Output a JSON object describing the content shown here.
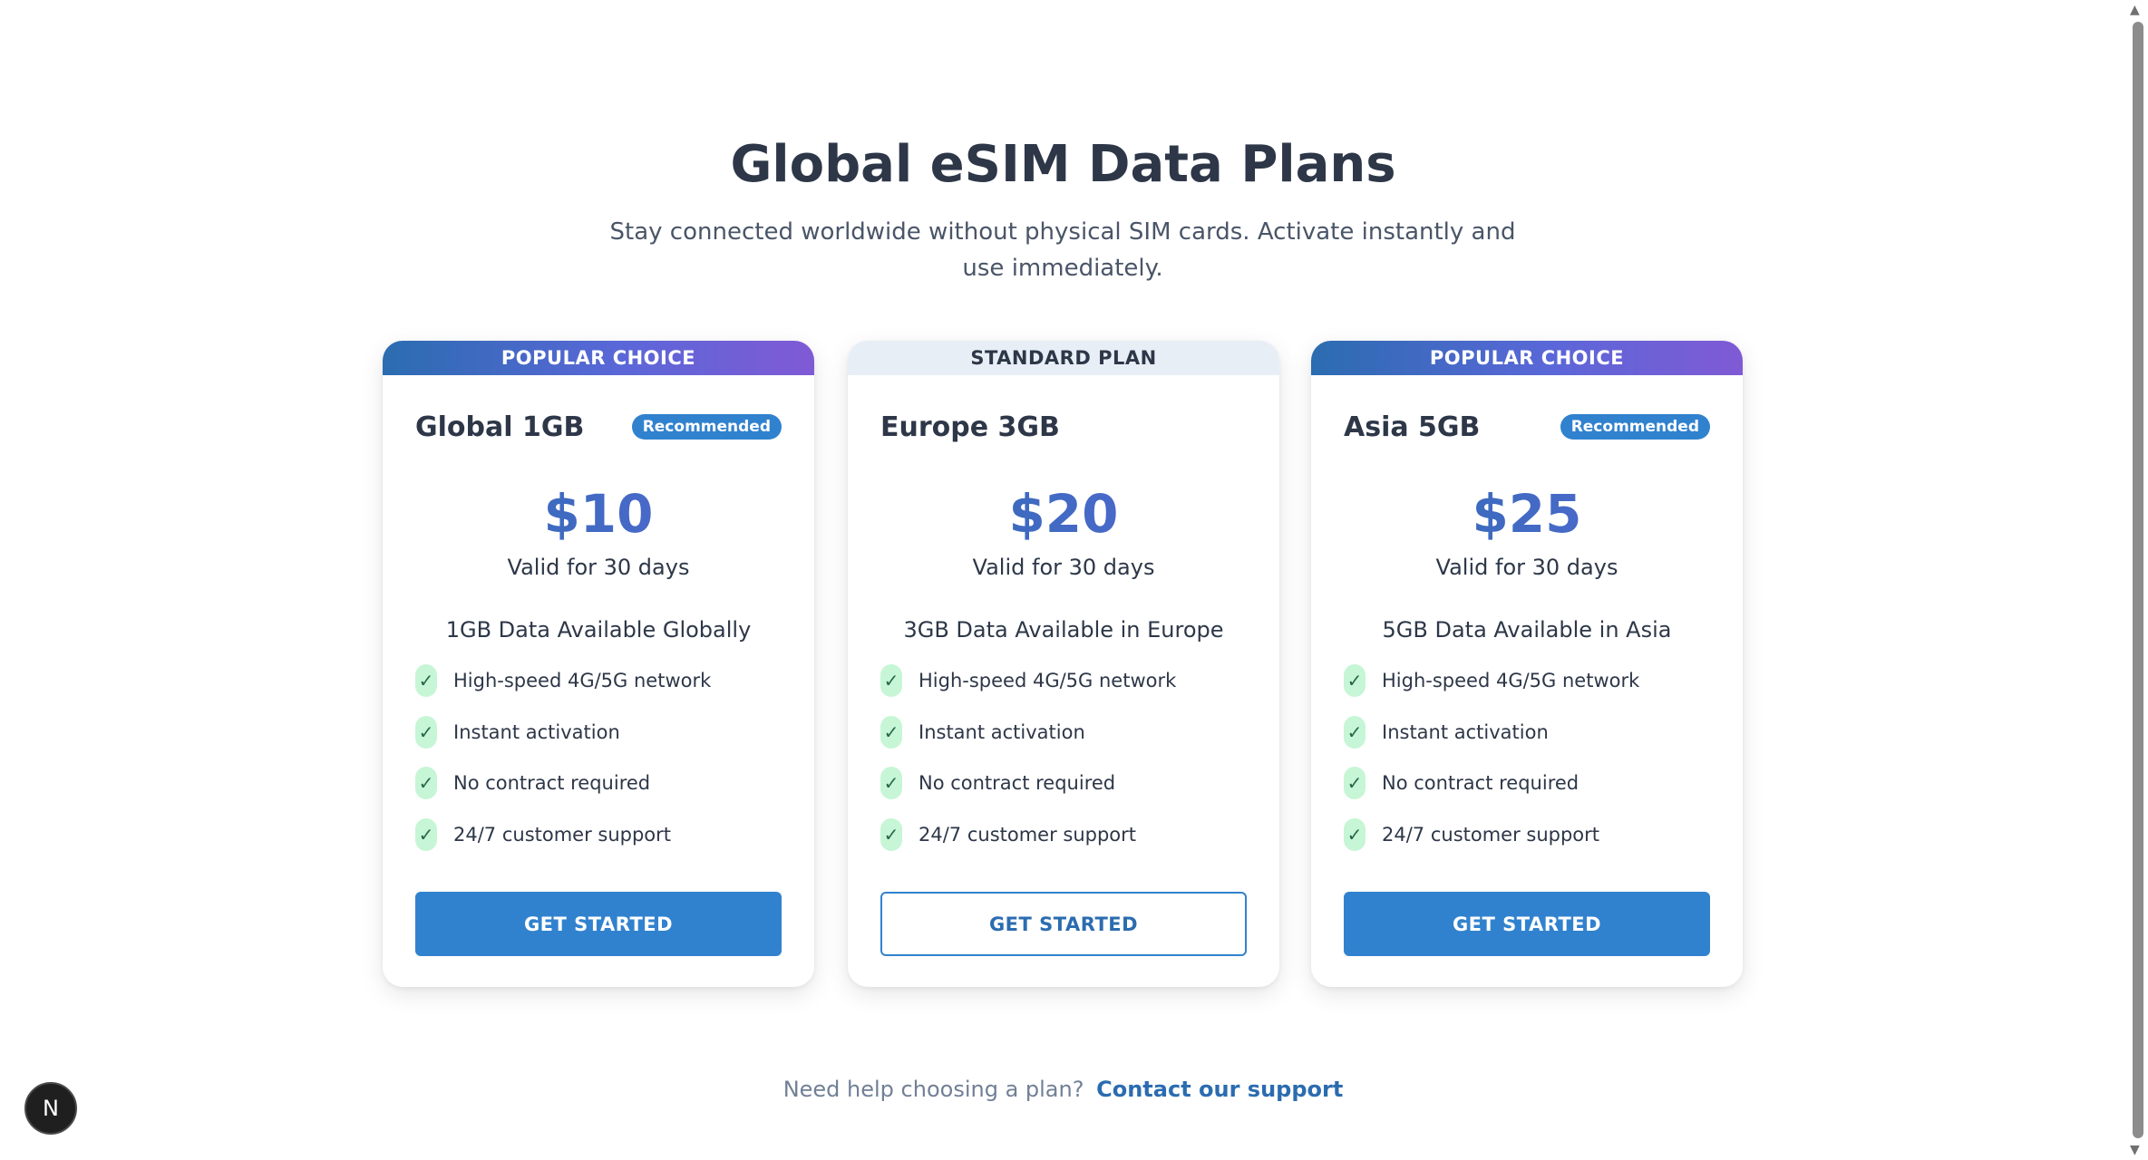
{
  "header": {
    "title": "Global eSIM Data Plans",
    "subtitle": "Stay connected worldwide without physical SIM cards. Activate instantly and use immediately."
  },
  "plans": [
    {
      "banner": "POPULAR CHOICE",
      "name": "Global 1GB",
      "badge": "Recommended",
      "price": "$10",
      "validity": "Valid for 30 days",
      "data_desc": "1GB Data Available Globally",
      "features": [
        "High-speed 4G/5G network",
        "Instant activation",
        "No contract required",
        "24/7 customer support"
      ],
      "button": "GET STARTED"
    },
    {
      "banner": "STANDARD PLAN",
      "name": "Europe 3GB",
      "badge": "",
      "price": "$20",
      "validity": "Valid for 30 days",
      "data_desc": "3GB Data Available in Europe",
      "features": [
        "High-speed 4G/5G network",
        "Instant activation",
        "No contract required",
        "24/7 customer support"
      ],
      "button": "GET STARTED"
    },
    {
      "banner": "POPULAR CHOICE",
      "name": "Asia 5GB",
      "badge": "Recommended",
      "price": "$25",
      "validity": "Valid for 30 days",
      "data_desc": "5GB Data Available in Asia",
      "features": [
        "High-speed 4G/5G network",
        "Instant activation",
        "No contract required",
        "24/7 customer support"
      ],
      "button": "GET STARTED"
    }
  ],
  "footer": {
    "help_text": "Need help choosing a plan?",
    "help_link": "Contact our support"
  },
  "fab": {
    "label": "N"
  },
  "icons": {
    "check": "✓",
    "scroll_up": "▲",
    "scroll_down": "▼"
  },
  "colors": {
    "accent": "#3182ce",
    "price": "#4c51bf",
    "check_bg": "#c6f6d5"
  }
}
